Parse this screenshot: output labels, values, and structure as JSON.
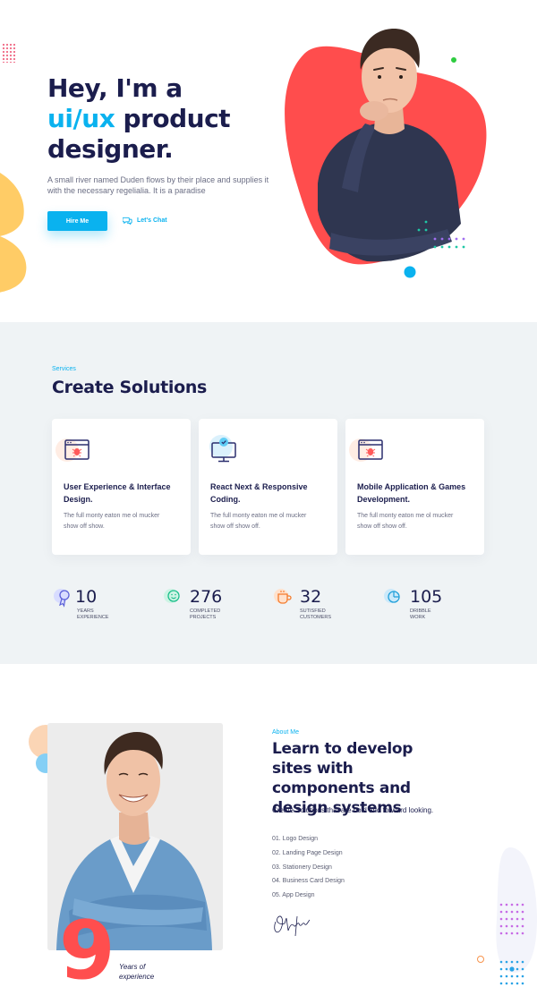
{
  "hero": {
    "title_line1": "Hey, I'm a",
    "title_accent": "ui/ux",
    "title_line2_rest": " product",
    "title_line3": "designer.",
    "description": "A small river named Duden flows by their place and supplies it with the necessary regelialia. It is a paradise",
    "hire_label": "Hire Me",
    "chat_label": "Let's Chat",
    "chat_icon": "chat-bubbles-icon",
    "accent_color": "#0ab2ef",
    "blob_color": "#ff4d4d"
  },
  "services": {
    "kicker": "Services",
    "title": "Create Solutions",
    "cards": [
      {
        "title": "User Experience & Interface Design.",
        "text": "The full monty eaton me ol mucker show off show.",
        "icon": "browser-bug-icon"
      },
      {
        "title": "React Next & Responsive Coding.",
        "text": "The full monty eaton me ol mucker show off show off.",
        "icon": "monitor-check-icon"
      },
      {
        "title": "Mobile Application & Games Development.",
        "text": "The full monty eaton me ol mucker show off show off.",
        "icon": "browser-bug-icon"
      }
    ],
    "stats": [
      {
        "number": "10",
        "label_line1": "Years",
        "label_line2": "Experience",
        "icon": "award-ribbon-icon"
      },
      {
        "number": "276",
        "label_line1": "Completed",
        "label_line2": "Projects",
        "icon": "smile-icon"
      },
      {
        "number": "32",
        "label_line1": "Sutisfied",
        "label_line2": "Customers",
        "icon": "coffee-cup-icon"
      },
      {
        "number": "105",
        "label_line1": "Dribble",
        "label_line2": "Work",
        "icon": "pie-chart-icon"
      }
    ]
  },
  "about": {
    "kicker": "About Me",
    "title": "Learn to develop sites with components and design systems",
    "subtitle": "Create Solutions that are bold and forward looking.",
    "list": [
      "01. Logo Design",
      "02. Landing Page Design",
      "03. Stationery Design",
      "04. Business Card Design",
      "05. App Design"
    ],
    "big_number": "9",
    "years_line1": "Years of",
    "years_line2": "experience",
    "signature_text": "Otentic"
  }
}
